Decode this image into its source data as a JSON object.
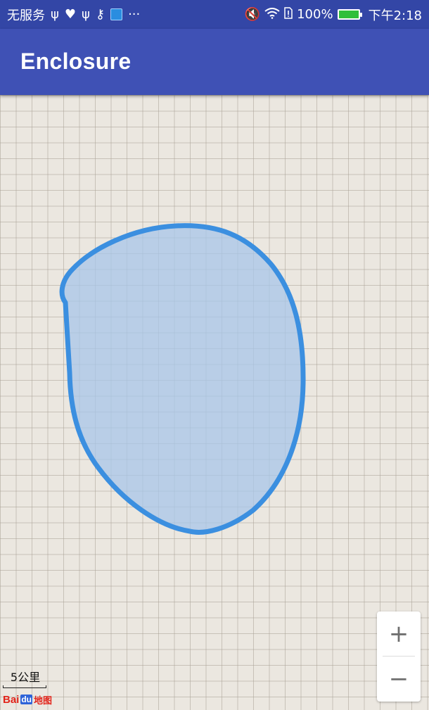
{
  "status_bar": {
    "carrier": "无服务",
    "extra_icons": [
      "usb-icon",
      "heart-rate-icon",
      "usb-icon",
      "key-icon",
      "app-icon",
      "more-icon"
    ],
    "overflow": "···",
    "battery": "100%",
    "time": "下午2:18"
  },
  "app_bar": {
    "title": "Enclosure",
    "color": "#3f51b5"
  },
  "map": {
    "enclosure_fill": "#a8c6ea",
    "enclosure_stroke": "#3b8fe0",
    "zoom_in": "+",
    "zoom_out": "−",
    "scale_label": "5公里",
    "logo_bai": "Bai",
    "logo_du": "du",
    "logo_map": "地图"
  }
}
